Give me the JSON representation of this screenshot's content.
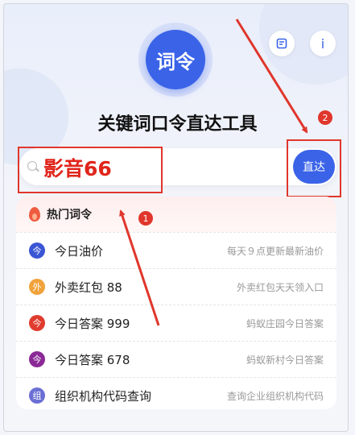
{
  "app": {
    "logo_text": "词令",
    "title": "关键词口令直达工具"
  },
  "top_buttons": {
    "notes_icon": "notes-icon",
    "info_label": "i"
  },
  "search": {
    "value": "影音66",
    "placeholder": "",
    "go_label": "直达"
  },
  "hot": {
    "heading": "热门词令",
    "items": [
      {
        "badge": "今",
        "badge_color": "#3a56d4",
        "title": "今日油价",
        "desc": "每天９点更新最新油价"
      },
      {
        "badge": "外",
        "badge_color": "#f0a23b",
        "title": "外卖红包 88",
        "desc": "外卖红包天天领入口"
      },
      {
        "badge": "今",
        "badge_color": "#e03b2e",
        "title": "今日答案 999",
        "desc": "蚂蚁庄园今日答案"
      },
      {
        "badge": "今",
        "badge_color": "#8b2a97",
        "title": "今日答案 678",
        "desc": "蚂蚁新村今日答案"
      },
      {
        "badge": "组",
        "badge_color": "#6b6fd4",
        "title": "组织机构代码查询",
        "desc": "查询企业组织机构代码"
      }
    ]
  },
  "annotations": {
    "marker1": "1",
    "marker2": "2",
    "color": "#e0362c"
  }
}
